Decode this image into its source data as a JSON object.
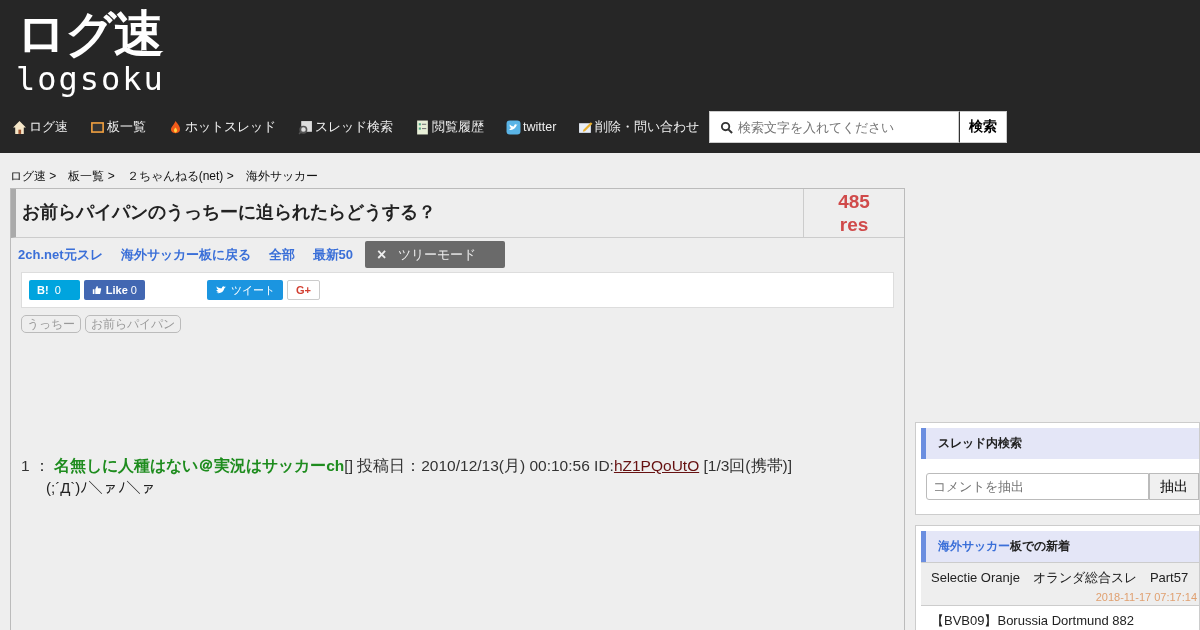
{
  "logo": {
    "title": "ログ速",
    "subtitle": "logsoku"
  },
  "nav": [
    "ログ速",
    "板一覧",
    "ホットスレッド",
    "スレッド検索",
    "閲覧履歴",
    "twitter",
    "削除・問い合わせ"
  ],
  "search": {
    "placeholder": "検索文字を入れてください",
    "button": "検索"
  },
  "breadcrumb": [
    "ログ速 >",
    "板一覧 >",
    "２ちゃんねる(net) >",
    "海外サッカー"
  ],
  "thread": {
    "title": "お前らパイパンのうっちーに迫られたらどうする？",
    "count": "485",
    "count_unit": "res"
  },
  "links": [
    "2ch.net元スレ",
    "海外サッカー板に戻る",
    "全部",
    "最新50"
  ],
  "tree_mode": {
    "icon": "×",
    "label": "ツリーモード"
  },
  "share": {
    "hatena": "B!",
    "hatena_count": "0",
    "like": "Like",
    "like_count": "0",
    "tweet": "ツイート",
    "gplus": "G+"
  },
  "tags": [
    "うっちー",
    "お前らパイパン"
  ],
  "posts": [
    {
      "number": "1",
      "sep": "：",
      "name": "名無しに人種はない＠実況はサッカーch",
      "mail": "[]",
      "date": "投稿日：2010/12/13(月) 00:10:56 ID:",
      "id": "hZ1PQoUtO",
      "extra": "[1/3回(携帯)]",
      "body": "(;´Д`)ﾉ＼ァﾉ＼ァ"
    }
  ],
  "thread_search": {
    "title": "スレッド内検索",
    "placeholder": "コメントを抽出",
    "button": "抽出"
  },
  "new_threads": {
    "board": "海外サッカー",
    "title_rest": "板での新着",
    "items": [
      {
        "title": "Selectie Oranje　オランダ総合スレ　Part57",
        "time": "2018-11-17 07:17:14"
      },
      {
        "title": "【BVB09】Borussia Dortmund 882"
      }
    ]
  }
}
